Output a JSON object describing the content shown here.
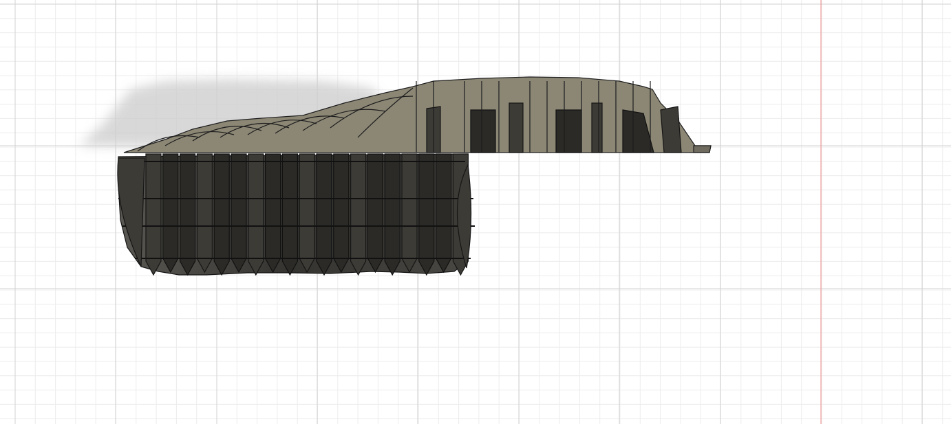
{
  "viewport": {
    "background": "#ffffff",
    "grid_minor_color": "#ececec",
    "grid_major_color": "#d2d2d2",
    "axis_color": "#f08a8a"
  },
  "model": {
    "surface_color": "#8c8775",
    "shadow_color": "#d9d9d9",
    "underside_color": "#3d3b36"
  }
}
